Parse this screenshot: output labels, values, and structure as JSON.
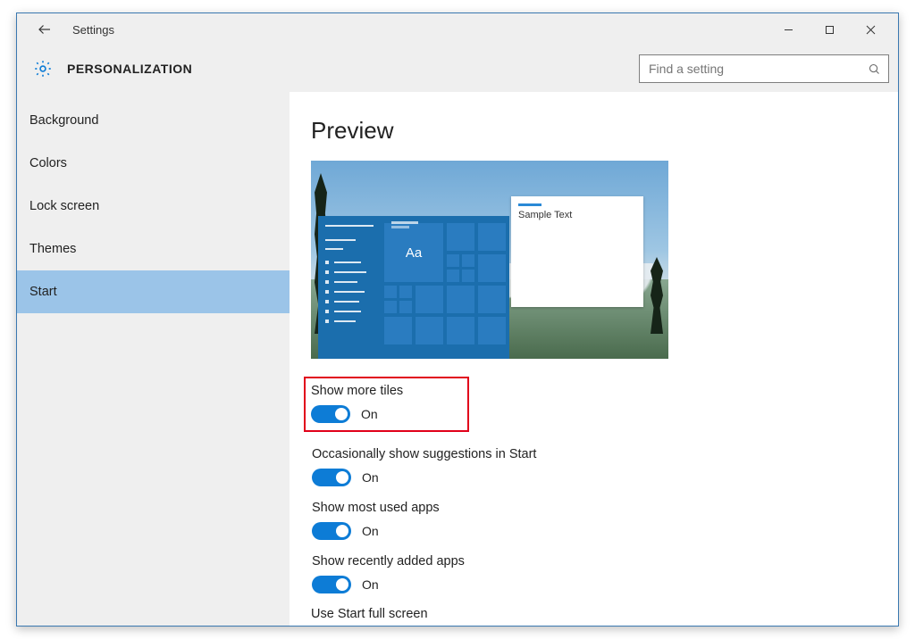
{
  "titlebar": {
    "title": "Settings"
  },
  "header": {
    "page_title": "PERSONALIZATION"
  },
  "search": {
    "placeholder": "Find a setting"
  },
  "sidebar": {
    "items": [
      {
        "label": "Background"
      },
      {
        "label": "Colors"
      },
      {
        "label": "Lock screen"
      },
      {
        "label": "Themes"
      },
      {
        "label": "Start"
      }
    ],
    "active_index": 4
  },
  "main": {
    "preview_heading": "Preview",
    "preview": {
      "aa_tile_text": "Aa",
      "sample_text": "Sample Text"
    },
    "settings": [
      {
        "label": "Show more tiles",
        "state": "On",
        "highlighted": true
      },
      {
        "label": "Occasionally show suggestions in Start",
        "state": "On",
        "highlighted": false
      },
      {
        "label": "Show most used apps",
        "state": "On",
        "highlighted": false
      },
      {
        "label": "Show recently added apps",
        "state": "On",
        "highlighted": false
      }
    ],
    "truncated_setting_label": "Use Start full screen"
  },
  "colors": {
    "accent": "#0d7cd6",
    "sidebar_active": "#9bc4e8",
    "highlight_border": "#e1001a"
  }
}
